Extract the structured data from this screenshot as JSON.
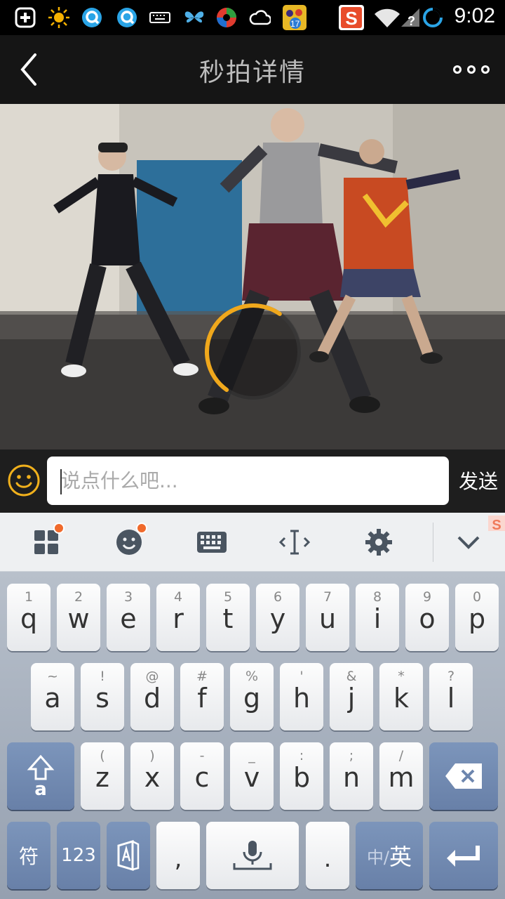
{
  "status_bar": {
    "time": "9:02",
    "icons": [
      "add-icon",
      "sun-icon",
      "qq-icon",
      "qq-icon",
      "keyboard-icon",
      "butterfly-icon",
      "swirl-icon",
      "cloud-icon",
      "calendar-17-icon",
      "sogou-icon",
      "wifi-icon",
      "signal-icon",
      "loading-icon"
    ],
    "calendar_day": "17"
  },
  "header": {
    "title": "秒拍详情"
  },
  "comment": {
    "placeholder": "说点什么吧...",
    "send_label": "发送"
  },
  "keyboard": {
    "row1": [
      {
        "sub": "1",
        "main": "q"
      },
      {
        "sub": "2",
        "main": "w"
      },
      {
        "sub": "3",
        "main": "e"
      },
      {
        "sub": "4",
        "main": "r"
      },
      {
        "sub": "5",
        "main": "t"
      },
      {
        "sub": "6",
        "main": "y"
      },
      {
        "sub": "7",
        "main": "u"
      },
      {
        "sub": "8",
        "main": "i"
      },
      {
        "sub": "9",
        "main": "o"
      },
      {
        "sub": "0",
        "main": "p"
      }
    ],
    "row2": [
      {
        "sub": "~",
        "main": "a"
      },
      {
        "sub": "!",
        "main": "s"
      },
      {
        "sub": "@",
        "main": "d"
      },
      {
        "sub": "#",
        "main": "f"
      },
      {
        "sub": "%",
        "main": "g"
      },
      {
        "sub": "'",
        "main": "h"
      },
      {
        "sub": "&",
        "main": "j"
      },
      {
        "sub": "*",
        "main": "k"
      },
      {
        "sub": "?",
        "main": "l"
      }
    ],
    "row3": [
      {
        "sub": "(",
        "main": "z"
      },
      {
        "sub": ")",
        "main": "x"
      },
      {
        "sub": "-",
        "main": "c"
      },
      {
        "sub": "_",
        "main": "v"
      },
      {
        "sub": ":",
        "main": "b"
      },
      {
        "sub": ";",
        "main": "n"
      },
      {
        "sub": "/",
        "main": "m"
      }
    ],
    "shift_sub": "a",
    "symbol_label": "符",
    "numbers_label": "123",
    "comma": ",",
    "period": ".",
    "lang_zh": "中/",
    "lang_en": "英"
  },
  "colors": {
    "accent": "#f0a81c",
    "key_dark": "#6d86ae",
    "badge": "#f06a2c"
  }
}
